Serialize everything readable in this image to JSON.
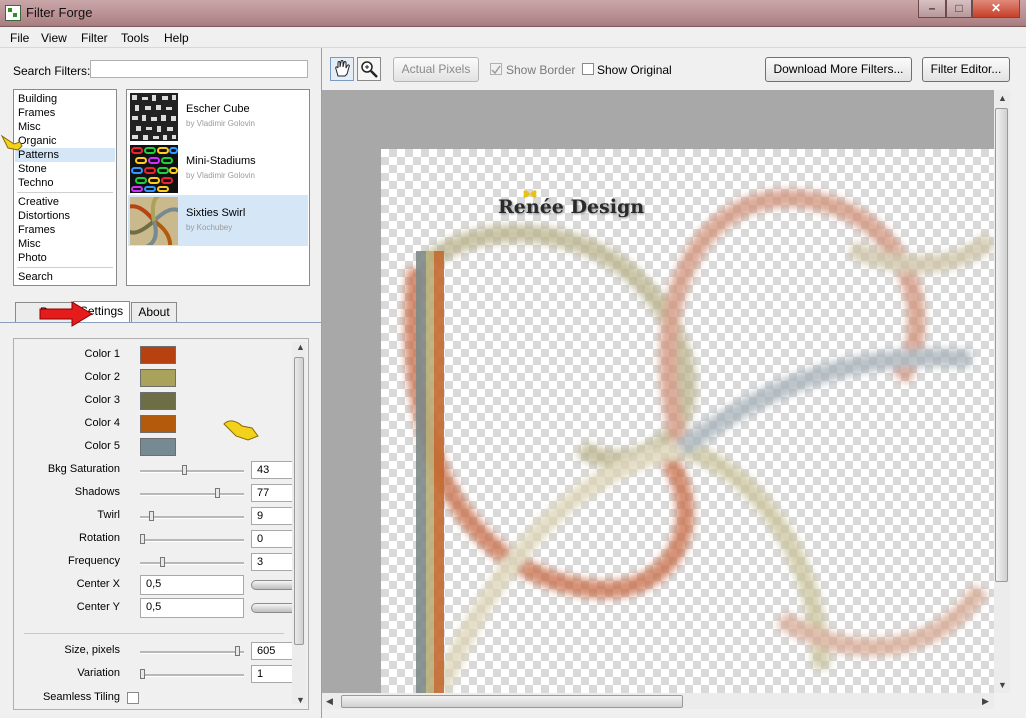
{
  "window": {
    "title": "Filter Forge"
  },
  "menu": [
    "File",
    "View",
    "Filter",
    "Tools",
    "Help"
  ],
  "search": {
    "label": "Search Filters:",
    "value": ""
  },
  "categories": {
    "group1": [
      "Building",
      "Frames",
      "Misc",
      "Organic",
      "Patterns",
      "Stone",
      "Techno"
    ],
    "group2": [
      "Creative",
      "Distortions",
      "Frames",
      "Misc",
      "Photo"
    ],
    "group3": [
      "Search"
    ],
    "selected": "Patterns"
  },
  "filters": [
    {
      "name": "Escher Cube",
      "author": "by Vladimir Golovin"
    },
    {
      "name": "Mini-Stadiums",
      "author": "by Vladimir Golovin"
    },
    {
      "name": "Sixties Swirl",
      "author": "by Kochubey",
      "selected": true
    }
  ],
  "tabs": {
    "presets": "P",
    "settings": "Settings",
    "about": "About",
    "active": "Settings"
  },
  "settings": {
    "colors": [
      {
        "label": "Color 1",
        "hex": "#b8420f"
      },
      {
        "label": "Color 2",
        "hex": "#a9a25a"
      },
      {
        "label": "Color 3",
        "hex": "#6e6e46"
      },
      {
        "label": "Color 4",
        "hex": "#b45a0c"
      },
      {
        "label": "Color 5",
        "hex": "#768a92"
      }
    ],
    "sliders": [
      {
        "label": "Bkg Saturation",
        "value": "43",
        "level": 0.43
      },
      {
        "label": "Shadows",
        "value": "77",
        "level": 0.77
      },
      {
        "label": "Twirl",
        "value": "9",
        "level": 0.09
      },
      {
        "label": "Rotation",
        "value": "0",
        "level": 0.0
      },
      {
        "label": "Frequency",
        "value": "3",
        "level": 0.2
      }
    ],
    "center_x": {
      "label": "Center X",
      "value": "0,5"
    },
    "center_y": {
      "label": "Center Y",
      "value": "0,5"
    },
    "size": {
      "label": "Size, pixels",
      "value": "605",
      "level": 0.97
    },
    "variation": {
      "label": "Variation",
      "value": "1",
      "level": 0.0
    },
    "seamless": {
      "label": "Seamless Tiling",
      "checked": false
    }
  },
  "toolbar": {
    "actual_pixels": "Actual Pixels",
    "show_border": "Show Border",
    "show_border_checked": true,
    "show_original": "Show Original",
    "show_original_checked": false,
    "download": "Download More Filters...",
    "editor": "Filter Editor..."
  },
  "watermark": "Renée Design"
}
